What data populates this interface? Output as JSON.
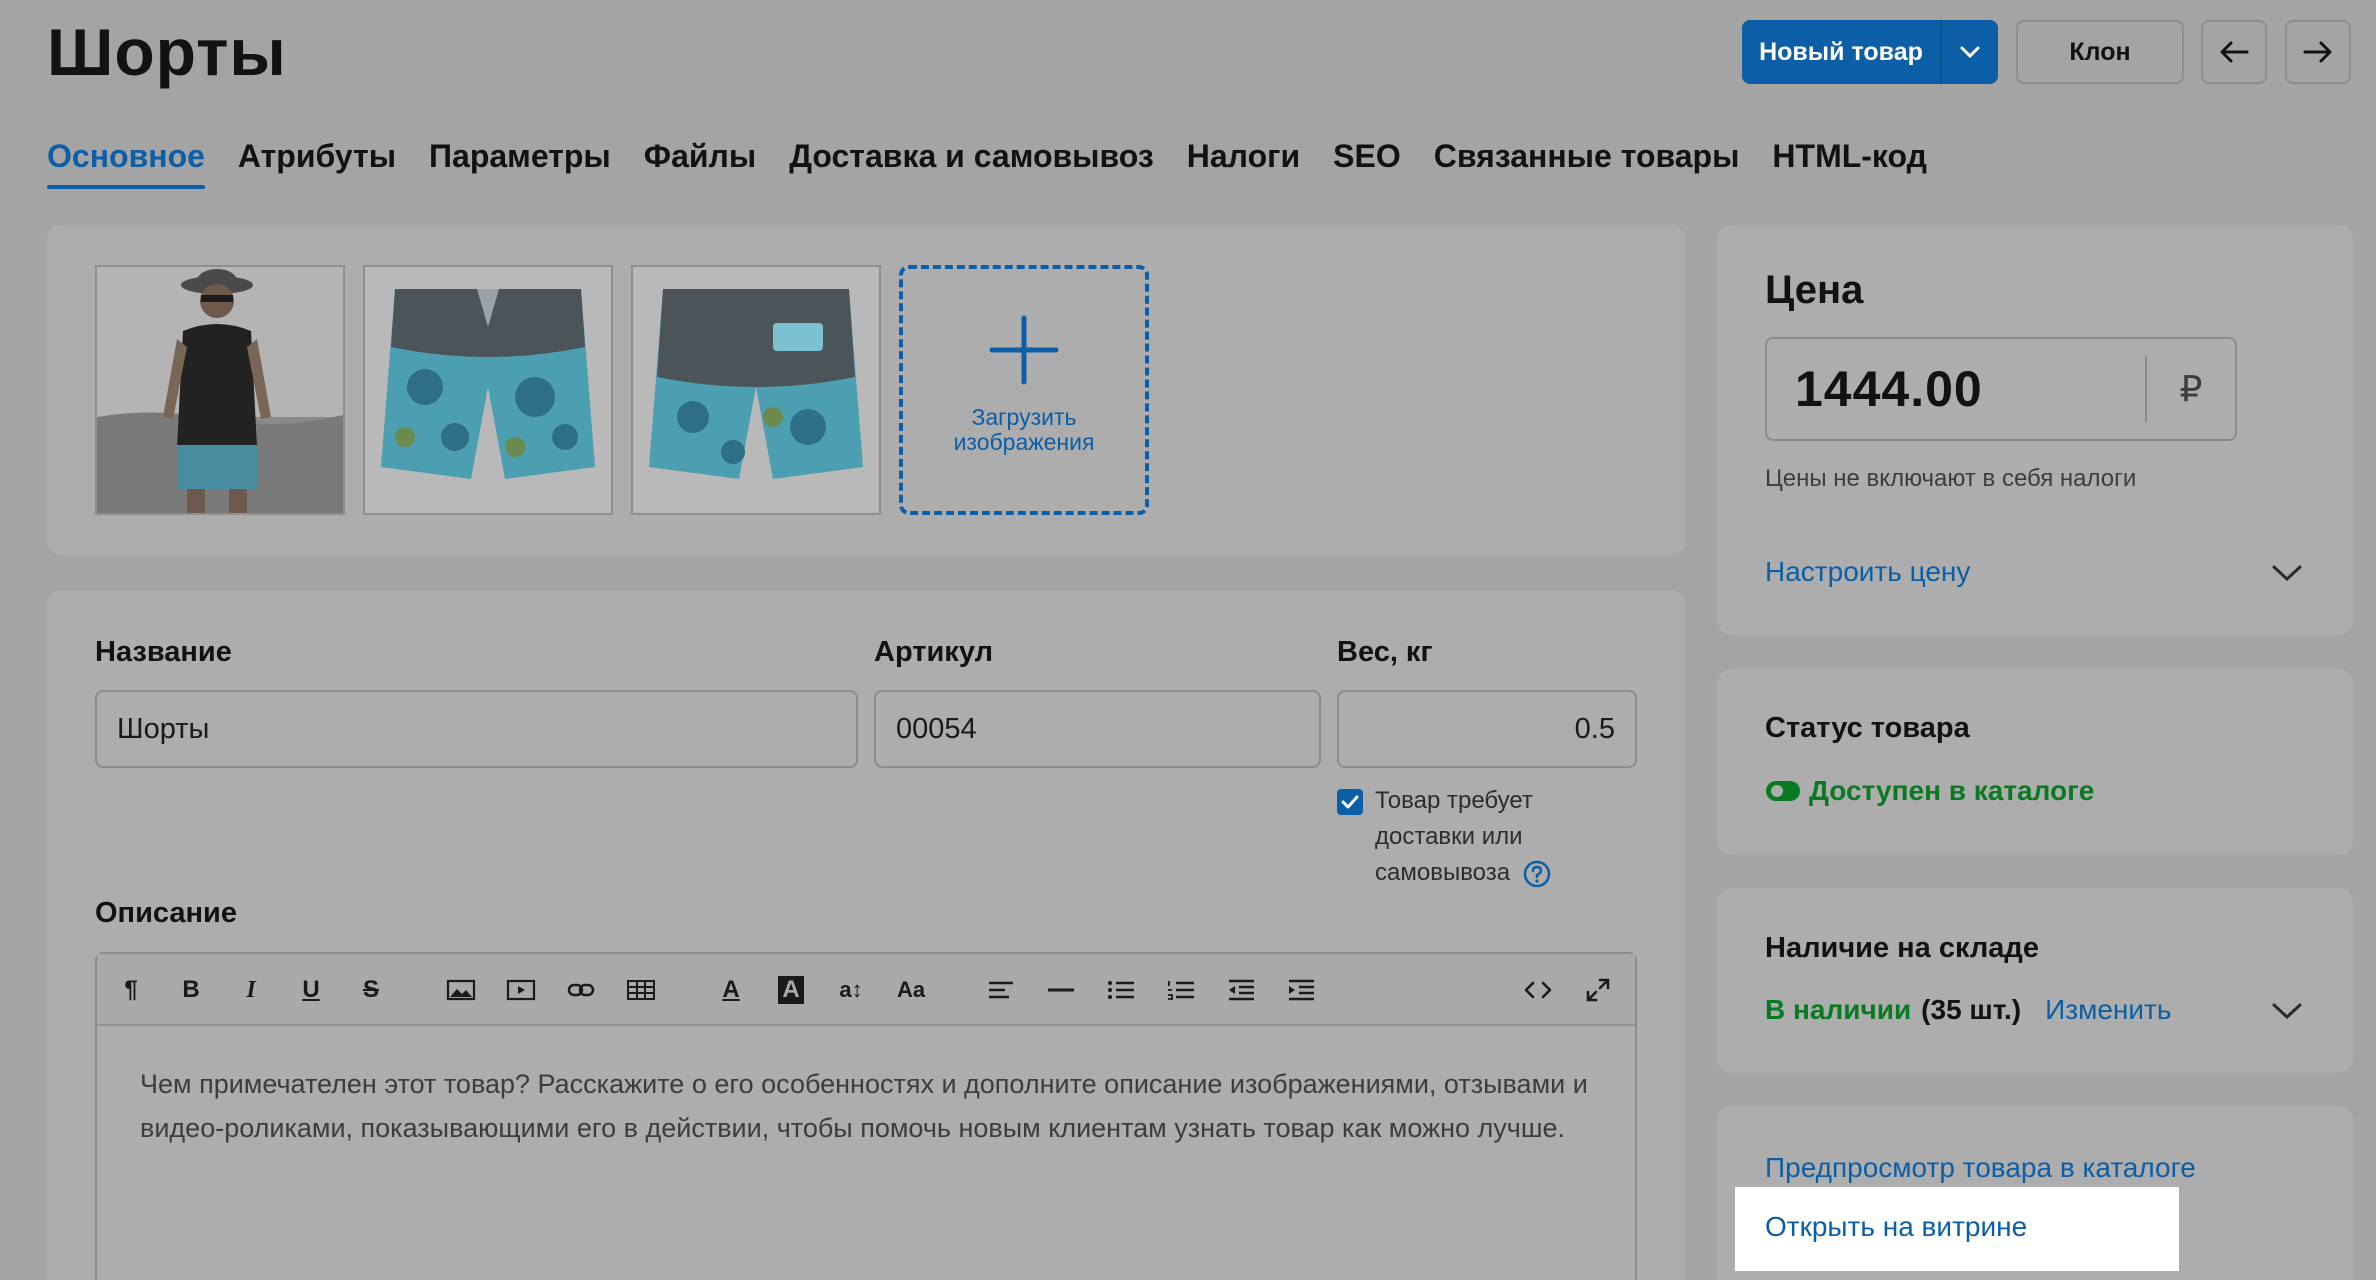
{
  "header": {
    "title": "Шорты",
    "new_product_label": "Новый товар",
    "clone_label": "Клон"
  },
  "tabs": [
    {
      "label": "Основное",
      "active": true
    },
    {
      "label": "Атрибуты"
    },
    {
      "label": "Параметры"
    },
    {
      "label": "Файлы"
    },
    {
      "label": "Доставка и самовывоз"
    },
    {
      "label": "Налоги"
    },
    {
      "label": "SEO"
    },
    {
      "label": "Связанные товары"
    },
    {
      "label": "HTML-код"
    }
  ],
  "images": {
    "upload_label": "Загрузить изображения"
  },
  "form": {
    "name_label": "Название",
    "name_value": "Шорты",
    "sku_label": "Артикул",
    "sku_value": "00054",
    "weight_label": "Вес, кг",
    "weight_value": "0.5",
    "shipping_checkbox_label": "Товар требует доставки или самовывоза",
    "shipping_checked": true,
    "description_label": "Описание",
    "description_placeholder": "Чем примечателен этот товар? Расскажите о его особенностях и дополните описание изображениями, отзывами и видео-роликами, показывающими его в действии, чтобы помочь новым клиентам узнать товар как можно лучше."
  },
  "toolbar": {
    "paragraph": "¶",
    "bold": "B",
    "italic": "I",
    "underline": "U",
    "strike": "S",
    "font_size": "a↕",
    "font": "Aa",
    "text_color": "A",
    "bg_color": "A"
  },
  "price": {
    "title": "Цена",
    "value": "1444.00",
    "currency": "₽",
    "note": "Цены не включают в себя налоги",
    "configure_link": "Настроить цену"
  },
  "status": {
    "title": "Статус товара",
    "value": "Доступен в каталоге",
    "color": "#0a7a22"
  },
  "stock": {
    "title": "Наличие на складе",
    "availability": "В наличии",
    "count": "(35 шт.)",
    "change_link": "Изменить"
  },
  "preview": {
    "preview_link": "Предпросмотр товара в каталоге",
    "open_link": "Открыть на витрине"
  },
  "colors": {
    "accent": "#0c5ea6",
    "success": "#0a7a22"
  }
}
